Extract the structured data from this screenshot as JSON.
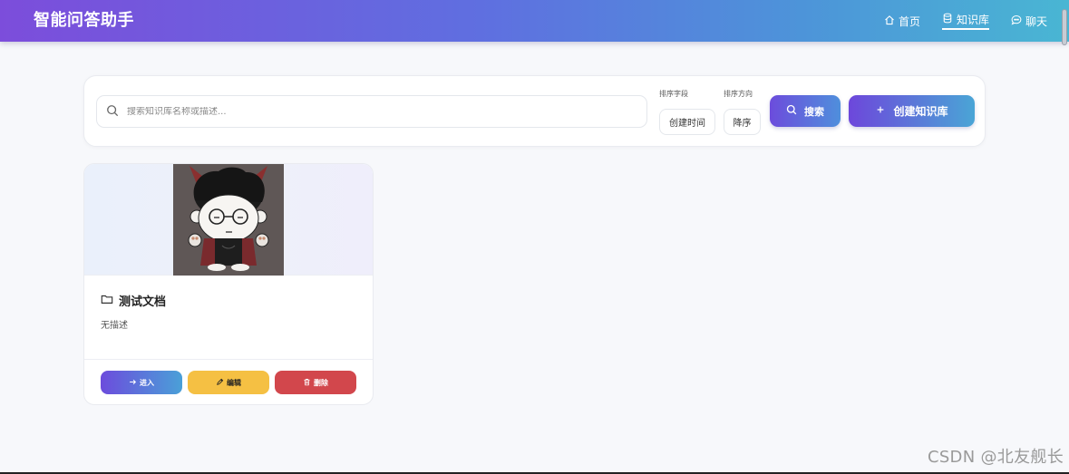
{
  "brand": {
    "title": "智能问答助手"
  },
  "nav": {
    "items": [
      {
        "label": "首页",
        "icon": "home-icon",
        "active": false
      },
      {
        "label": "知识库",
        "icon": "database-icon",
        "active": true
      },
      {
        "label": "聊天",
        "icon": "chat-bubble-icon",
        "active": false
      }
    ]
  },
  "search": {
    "placeholder": "搜索知识库名称或描述...",
    "value": "",
    "sort_field_label": "排序字段",
    "sort_field_value": "创建时间",
    "sort_order_label": "排序方向",
    "sort_order_value": "降序",
    "search_button": "搜索",
    "create_button": "创建知识库"
  },
  "knowledge_bases": [
    {
      "name": "测试文档",
      "description": "无描述",
      "enter_label": "进入",
      "edit_label": "编辑",
      "delete_label": "删除"
    }
  ],
  "watermark": "CSDN @北友舰长",
  "colors": {
    "nav_gradient_start": "#7c4ddb",
    "nav_gradient_end": "#49b6d3",
    "edit_button": "#f5c043",
    "delete_button": "#d2474c"
  }
}
